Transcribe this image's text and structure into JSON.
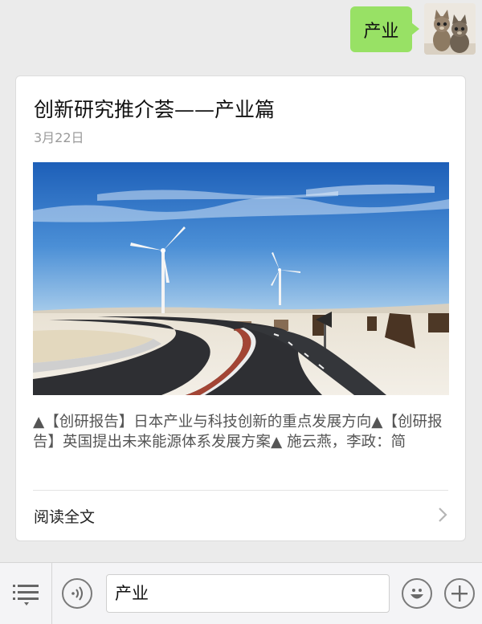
{
  "message": {
    "text": "产业"
  },
  "article": {
    "title": "创新研究推介荟——产业篇",
    "date": "3月22日",
    "summary": "▲【创研报告】日本产业与科技创新的重点发展方向▲【创研报告】英国提出未来能源体系发展方案▲ 施云燕，李政：简",
    "read_more": "阅读全文"
  },
  "input_bar": {
    "value": "产业"
  },
  "icons": {
    "menu": "menu-icon",
    "voice": "voice-icon",
    "emoji": "emoji-icon",
    "add": "plus-icon",
    "chevron": "chevron-right-icon"
  },
  "colors": {
    "bubble": "#98e165",
    "background": "#ebebeb"
  }
}
